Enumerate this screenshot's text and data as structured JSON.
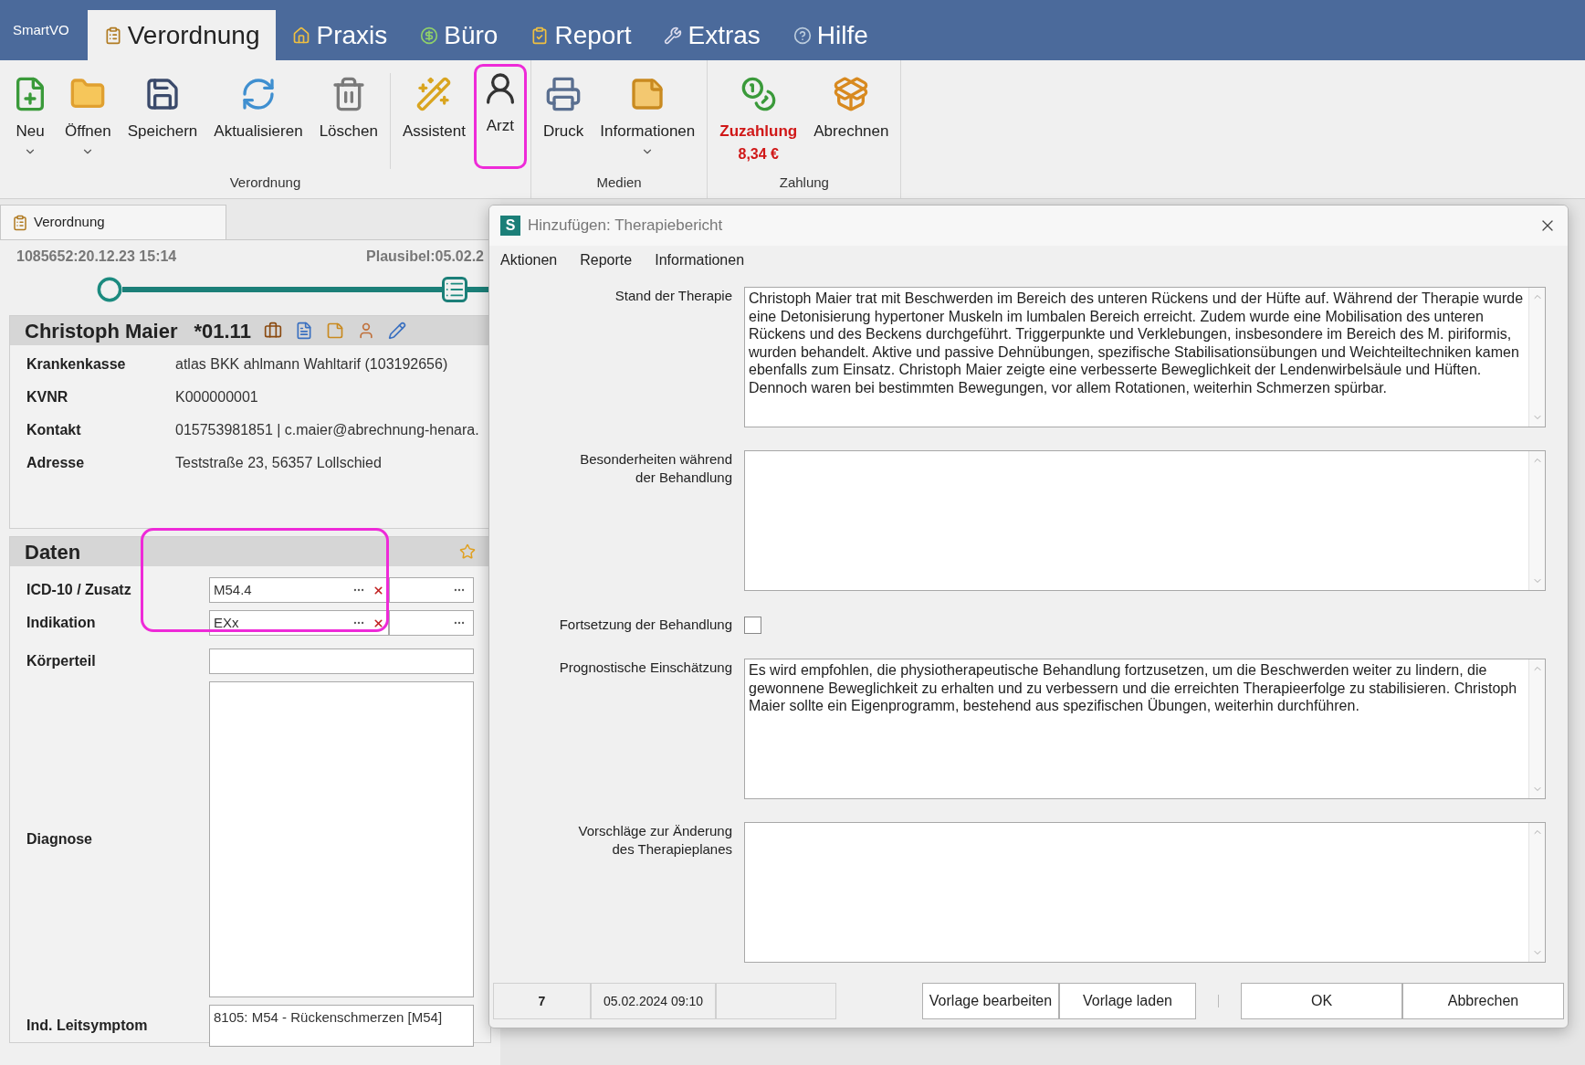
{
  "app_tabs": [
    {
      "label": "SmartVO",
      "kind": "brand",
      "selected": false
    },
    {
      "label": "Verordnung",
      "kind": "clipboard",
      "selected": true
    },
    {
      "label": "Praxis",
      "kind": "home",
      "selected": false
    },
    {
      "label": "Büro",
      "kind": "coins",
      "selected": false
    },
    {
      "label": "Report",
      "kind": "check",
      "selected": false
    },
    {
      "label": "Extras",
      "kind": "tools",
      "selected": false
    },
    {
      "label": "Hilfe",
      "kind": "help",
      "selected": false
    }
  ],
  "ribbon": [
    {
      "label": "Verordnung",
      "buttons": [
        {
          "label": "Neu",
          "kind": "new",
          "dropdown": true,
          "highlighted": false
        },
        {
          "label": "Öffnen",
          "kind": "open",
          "dropdown": true,
          "highlighted": false
        },
        {
          "label": "Speichern",
          "kind": "save",
          "dropdown": false,
          "highlighted": false
        },
        {
          "label": "Aktualisieren",
          "kind": "refresh",
          "dropdown": false,
          "highlighted": false
        },
        {
          "label": "Löschen",
          "kind": "delete",
          "dropdown": false,
          "highlighted": false
        },
        {
          "label": "Assistent",
          "kind": "wizard",
          "dropdown": false,
          "highlighted": false
        },
        {
          "label": "Arzt",
          "kind": "doctor",
          "dropdown": false,
          "highlighted": true
        }
      ]
    },
    {
      "label": "Medien",
      "buttons": [
        {
          "label": "Druck",
          "kind": "print",
          "dropdown": false,
          "highlighted": false
        },
        {
          "label": "Informationen",
          "kind": "notes",
          "dropdown": true,
          "highlighted": false
        }
      ]
    },
    {
      "label": "Zahlung",
      "buttons": [
        {
          "label": "Zuzahlung",
          "kind": "payment",
          "amount": "8,34 €",
          "dropdown": false,
          "highlighted": false
        },
        {
          "label": "Abrechnen",
          "kind": "bill",
          "dropdown": false,
          "highlighted": false
        }
      ]
    }
  ],
  "document_tab": {
    "label": "Verordnung"
  },
  "record": {
    "id_line": "1085652:20.12.23 15:14",
    "plausibel": "Plausibel:05.02.2"
  },
  "patient": {
    "name": "Christoph Maier",
    "birth": "*01.11",
    "rows": [
      {
        "label": "Krankenkasse",
        "value": "atlas BKK ahlmann Wahltarif (103192656)"
      },
      {
        "label": "KVNR",
        "value": "K000000001"
      },
      {
        "label": "Kontakt",
        "value": "015753981851 | c.maier@abrechnung-henara."
      },
      {
        "label": "Adresse",
        "value": "Teststraße 23,  56357 Lollschied"
      }
    ]
  },
  "daten": {
    "title": "Daten",
    "highlighted": true,
    "fields": [
      {
        "label": "ICD-10 / Zusatz",
        "kind": "lookup",
        "value": "M54.4"
      },
      {
        "label": "Indikation",
        "kind": "lookup",
        "value": "EXx"
      },
      {
        "label": "Körperteil",
        "kind": "text"
      },
      {
        "label": "Diagnose",
        "kind": "textarea"
      },
      {
        "label": "Ind. Leitsymptom",
        "kind": "memo",
        "value": "8105: M54 - Rückenschmerzen [M54]"
      }
    ]
  },
  "dialog": {
    "logo": "S",
    "title": "Hinzufügen: Therapiebericht",
    "menu": [
      "Aktionen",
      "Reporte",
      "Informationen"
    ],
    "fields": [
      {
        "label": "Stand der Therapie",
        "kind": "textarea",
        "value": "Christoph Maier trat mit Beschwerden im Bereich des unteren Rückens und der Hüfte auf. Während der Therapie wurde eine Detonisierung hypertoner Muskeln im lumbalen Bereich erreicht. Zudem wurde eine Mobilisation des unteren Rückens und des Beckens durchgeführt. Triggerpunkte und Verklebungen, insbesondere im Bereich des M. piriformis, wurden behandelt. Aktive und passive Dehnübungen, spezifische Stabilisationsübungen und Weichteiltechniken kamen ebenfalls zum Einsatz. Christoph Maier zeigte eine verbesserte Beweglichkeit der Lendenwirbelsäule und Hüften. Dennoch waren bei bestimmten Bewegungen, vor allem Rotationen, weiterhin Schmerzen spürbar."
      },
      {
        "label": "Besonderheiten während\nder Behandlung",
        "kind": "textarea"
      },
      {
        "label": "Fortsetzung der Behandlung",
        "kind": "checkbox",
        "checked": false
      },
      {
        "label": "Prognostische Einschätzung",
        "kind": "textarea",
        "value": "Es wird empfohlen, die physiotherapeutische Behandlung fortzusetzen, um die Beschwerden weiter zu lindern, die gewonnene Beweglichkeit zu erhalten und zu verbessern und die erreichten Therapieerfolge zu stabilisieren. Christoph Maier sollte ein Eigenprogramm, bestehend aus spezifischen Übungen, weiterhin durchführen."
      },
      {
        "label": "Vorschläge zur Änderung\ndes Therapieplanes",
        "kind": "textarea"
      }
    ],
    "status": [
      "7",
      "05.02.2024 09:10"
    ],
    "template_buttons": [
      "Vorlage bearbeiten",
      "Vorlage laden"
    ],
    "buttons": [
      "OK",
      "Abbrechen"
    ]
  }
}
